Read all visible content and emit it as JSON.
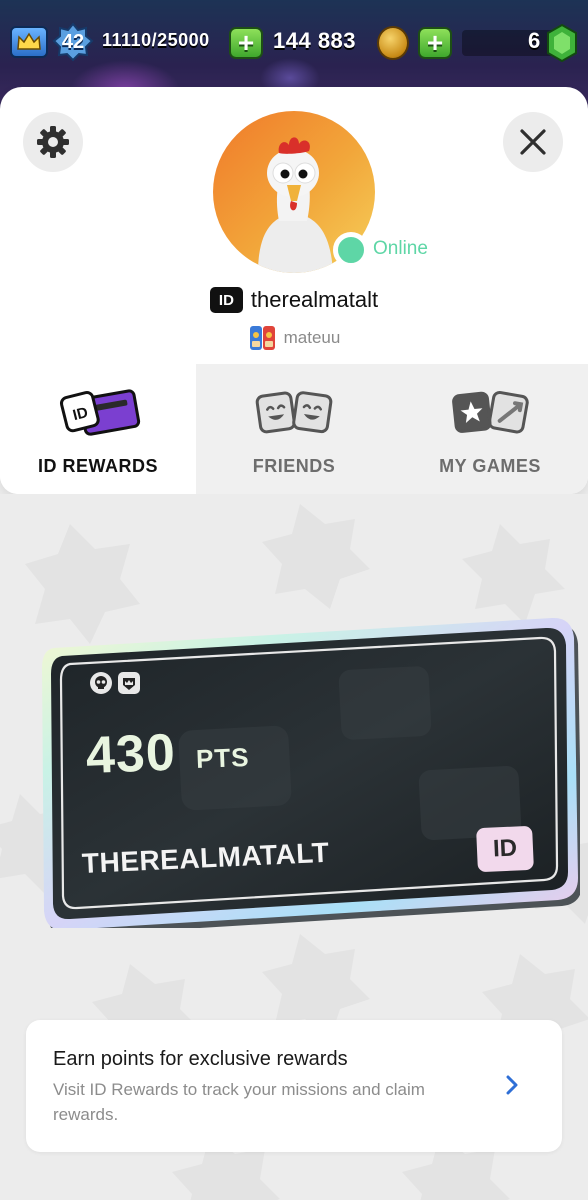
{
  "status_bar": {
    "level": "42",
    "xp": "11110/25000",
    "gold": "144 883",
    "gems": "6",
    "icons": [
      "crown-icon",
      "level-star-icon",
      "add-icon",
      "gold-coin-icon",
      "gem-icon"
    ]
  },
  "profile": {
    "online_status": "Online",
    "id_badge": "ID",
    "username": "therealmatalt",
    "game_name": "mateuu",
    "colors": {
      "online": "#5ed6a6"
    }
  },
  "tabs": [
    {
      "label": "ID REWARDS",
      "active": true,
      "icon": "id-card-icon"
    },
    {
      "label": "FRIENDS",
      "active": false,
      "icon": "friends-faces-icon"
    },
    {
      "label": "MY GAMES",
      "active": false,
      "icon": "games-cards-icon"
    }
  ],
  "points_card": {
    "points": "430",
    "points_unit": "PTS",
    "name": "THEREALMATALT",
    "id_badge": "ID"
  },
  "info_card": {
    "title": "Earn points for exclusive rewards",
    "body": "Visit ID Rewards to track your missions and claim rewards."
  }
}
